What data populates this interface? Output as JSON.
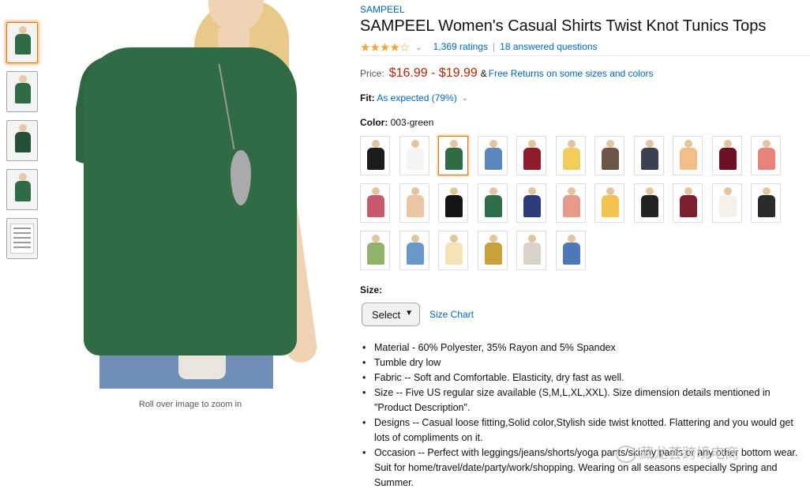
{
  "thumbnails": [
    {
      "kind": "photo",
      "selected": true
    },
    {
      "kind": "photo",
      "selected": false
    },
    {
      "kind": "photo",
      "selected": false
    },
    {
      "kind": "photo",
      "selected": false
    },
    {
      "kind": "size-chart-sheet",
      "selected": false
    }
  ],
  "image_hint": "Roll over image to zoom in",
  "product": {
    "brand": "SAMPEEL",
    "title": "SAMPEEL Women's Casual Shirts Twist Knot Tunics Tops",
    "stars": "★★★★☆",
    "rating_value": 4.5,
    "ratings_link": "1,369 ratings",
    "separator": "|",
    "questions_link": "18 answered questions"
  },
  "price": {
    "label": "Price:",
    "range": "$16.99 - $19.99",
    "amp": "&",
    "returns": "Free Returns on some sizes and colors"
  },
  "fit": {
    "label": "Fit:",
    "value": "As expected (79%)"
  },
  "color": {
    "label": "Color:",
    "value": "003-green",
    "swatches": [
      {
        "color": "#1c1c1c",
        "selected": false
      },
      {
        "color": "#f4f4f4",
        "selected": false
      },
      {
        "color": "#2f6b45",
        "selected": true
      },
      {
        "color": "#5b87bd",
        "selected": false
      },
      {
        "color": "#8e1c2a",
        "selected": false
      },
      {
        "color": "#f2cd5c",
        "selected": false
      },
      {
        "color": "#6b5546",
        "selected": false
      },
      {
        "color": "#3b4150",
        "selected": false
      },
      {
        "color": "#f2bd86",
        "selected": false
      },
      {
        "color": "#6e1124",
        "selected": false
      },
      {
        "color": "#e8837b",
        "selected": false
      },
      {
        "color": "#c95a6e",
        "selected": false
      },
      {
        "color": "#ecc6a4",
        "selected": false
      },
      {
        "color": "#151515",
        "selected": false
      },
      {
        "color": "#2e6e4a",
        "selected": false
      },
      {
        "color": "#2d3d7a",
        "selected": false
      },
      {
        "color": "#e79a8c",
        "selected": false
      },
      {
        "color": "#f5c24f",
        "selected": false
      },
      {
        "color": "#222222",
        "selected": false
      },
      {
        "color": "#7a1f2b",
        "selected": false
      },
      {
        "color": "#f5f1ea",
        "selected": false
      },
      {
        "color": "#2b2b2b",
        "selected": false
      },
      {
        "color": "#8fb36a",
        "selected": false
      },
      {
        "color": "#6a97c9",
        "selected": false
      },
      {
        "color": "#f4e3b8",
        "selected": false
      },
      {
        "color": "#c9a13a",
        "selected": false
      },
      {
        "color": "#d8d2c8",
        "selected": false
      },
      {
        "color": "#4f78b8",
        "selected": false
      }
    ]
  },
  "size": {
    "label": "Size:",
    "select_label": "Select",
    "chart_link": "Size Chart"
  },
  "bullets": [
    "Material - 60% Polyester, 35% Rayon and 5% Spandex",
    "Tumble dry low",
    "Fabric -- Soft and Comfortable. Elasticity, dry fast as well.",
    "Size -- Five US regular size available (S,M,L,XL,XXL). Size dimension details mentioned in \"Product Description\".",
    "Designs -- Casual loose fitting,Solid color,Stylish side twist knotted. Flattering and you would get lots of compliments on it.",
    "Occasion -- Perfect with leggings/jeans/shorts/yoga pants/skinny pants or any other bottom wear. Suit for home/travel/date/party/work/shopping. Wearing on all seasons especially Spring and Summer."
  ],
  "watermark": "藏龙荟跨境电商",
  "colors": {
    "link": "#0066c0",
    "price": "#b12704",
    "star": "#f0a63b",
    "selected_border": "#e77600"
  }
}
